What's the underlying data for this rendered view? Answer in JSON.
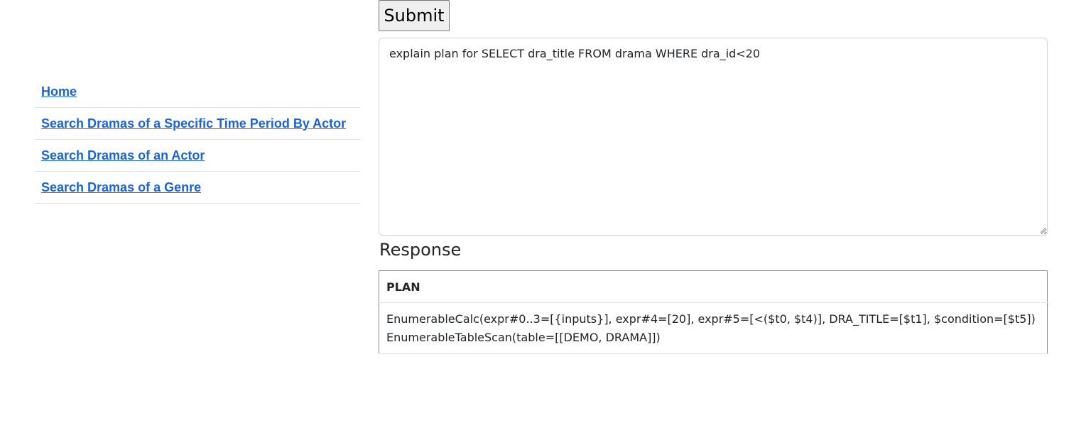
{
  "sidebar": {
    "items": [
      {
        "label": "Home"
      },
      {
        "label": "Search Dramas of a Specific Time Period By Actor"
      },
      {
        "label": "Search Dramas of an Actor"
      },
      {
        "label": "Search Dramas of a Genre"
      }
    ]
  },
  "form": {
    "submit_label": "Submit",
    "query_value": "explain plan for SELECT dra_title FROM drama WHERE dra_id<20"
  },
  "response": {
    "heading": "Response",
    "table": {
      "columns": [
        "PLAN"
      ],
      "rows": [
        [
          "EnumerableCalc(expr#0..3=[{inputs}], expr#4=[20], expr#5=[<($t0, $t4)], DRA_TITLE=[$t1], $condition=[$t5])\nEnumerableTableScan(table=[[DEMO, DRAMA]])"
        ]
      ]
    }
  },
  "colors": {
    "link": "#1a64d6",
    "border": "#dee2e6",
    "text": "#212529"
  }
}
